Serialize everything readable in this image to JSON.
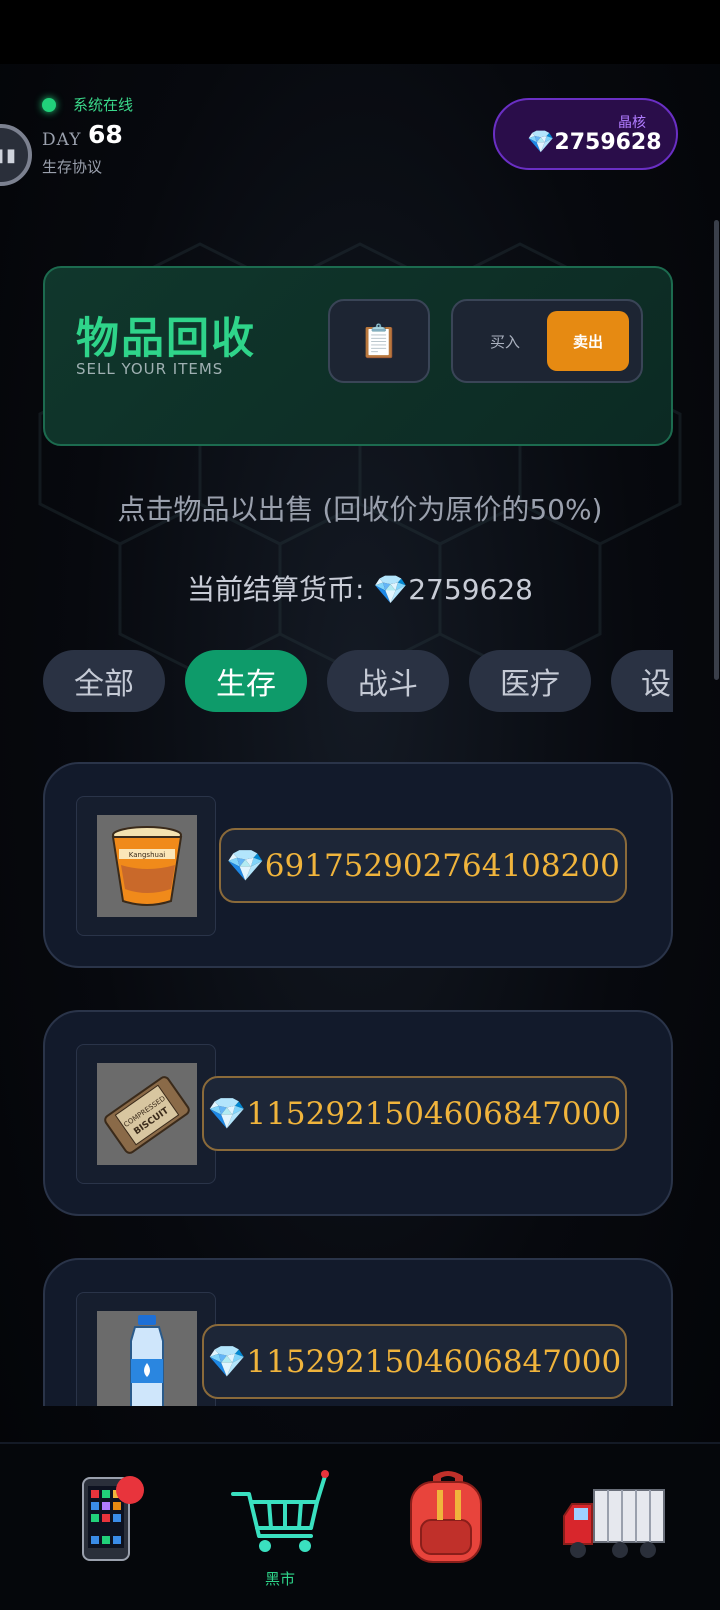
{
  "header": {
    "status_text": "系统在线",
    "day_label": "DAY",
    "day_number": "68",
    "protocol_label": "生存协议",
    "crystal_label": "晶核",
    "crystal_value": "💎2759628"
  },
  "panel": {
    "title": "物品回收",
    "subtitle": "SELL YOUR ITEMS",
    "clipboard_icon": "📋",
    "buy_label": "买入",
    "sell_label": "卖出"
  },
  "hint_text": "点击物品以出售 (回收价为原价的50%)",
  "currency_text": "当前结算货币: 💎2759628",
  "tabs": [
    {
      "label": "全部",
      "active": false
    },
    {
      "label": "生存",
      "active": true
    },
    {
      "label": "战斗",
      "active": false
    },
    {
      "label": "医疗",
      "active": false
    },
    {
      "label": "设",
      "active": false
    }
  ],
  "items": [
    {
      "icon": "instant-noodle-cup",
      "price": "💎691752902764108200"
    },
    {
      "icon": "compressed-biscuit",
      "price": "💎1152921504606847000"
    },
    {
      "icon": "water-bottle",
      "price": "💎1152921504606847000"
    }
  ],
  "nav": [
    {
      "icon": "phone-icon",
      "label": "",
      "has_badge": true
    },
    {
      "icon": "shopping-cart-icon",
      "label": "黑市",
      "has_badge": false
    },
    {
      "icon": "backpack-icon",
      "label": "",
      "has_badge": false
    },
    {
      "icon": "truck-icon",
      "label": "",
      "has_badge": false
    }
  ],
  "colors": {
    "accent_green": "#2fd48a",
    "sell_orange": "#e68a12",
    "price_gold": "#f0b43c",
    "crystal_purple": "#6a2fc4"
  }
}
